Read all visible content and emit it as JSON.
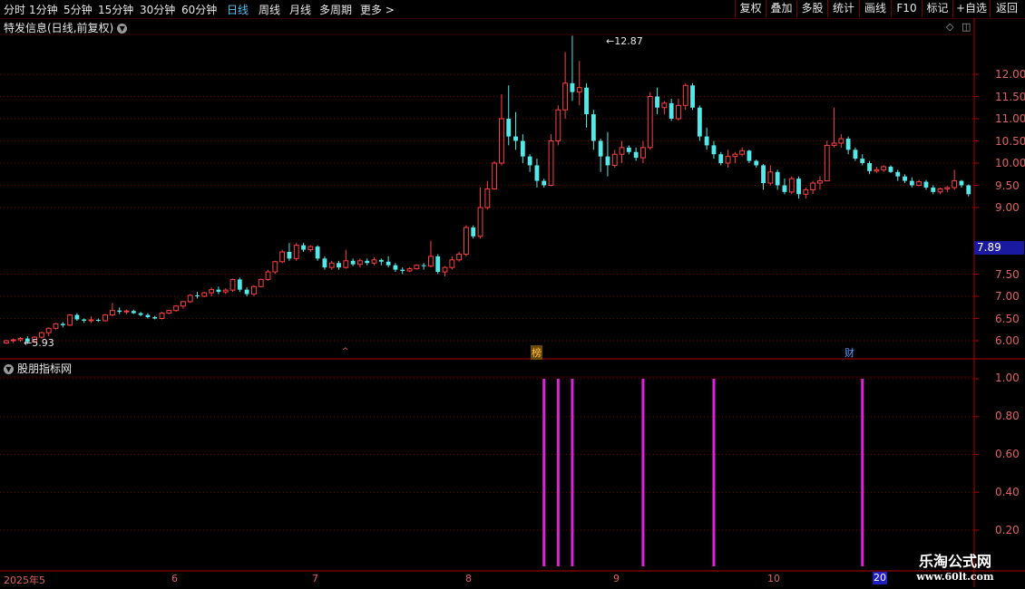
{
  "toolbar": {
    "periods": [
      "分时",
      "1分钟",
      "5分钟",
      "15分钟",
      "30分钟",
      "60分钟",
      "日线",
      "周线",
      "月线",
      "多周期",
      "更多 >"
    ],
    "active_period": "日线",
    "right_buttons": [
      "复权",
      "叠加",
      "多股",
      "统计",
      "画线",
      "F10",
      "标记",
      "+自选",
      "返回"
    ]
  },
  "price_panel": {
    "title": "特发信息(日线,前复权)",
    "high_label": "12.87",
    "low_label": "5.93",
    "current_price": "7.89",
    "y_ticks": [
      "12.00",
      "11.50",
      "11.00",
      "10.50",
      "10.00",
      "9.50",
      "9.00",
      "7.50",
      "7.00",
      "6.50",
      "6.00"
    ],
    "event_markers": [
      {
        "text": "榜",
        "color": "#e0a020"
      },
      {
        "text": "财",
        "color": "#3b82f6"
      },
      {
        "text": "^",
        "color": "#e04040"
      }
    ],
    "colors": {
      "up": "#ff4040",
      "down": "#54e8e8",
      "grid": "#7a0000"
    }
  },
  "indicator_panel": {
    "title": "股朋指标网",
    "y_ticks": [
      "1.00",
      "0.80",
      "0.60",
      "0.40",
      "0.20"
    ],
    "signal_color": "#e020e0"
  },
  "x_axis": {
    "labels": [
      "2025年5",
      "6",
      "7",
      "8",
      "9",
      "10"
    ],
    "current_label": "20"
  },
  "watermark": {
    "line1": "乐淘公式网",
    "line2": "www.60lt.com"
  },
  "chart_data": [
    {
      "type": "candlestick",
      "title": "特发信息(日线,前复权)",
      "x_labels": [
        "2025年5",
        "6",
        "7",
        "8",
        "9",
        "10",
        "20"
      ],
      "ylim": [
        5.7,
        13.0
      ],
      "candles": [
        [
          5.95,
          6.02,
          5.93,
          6.0
        ],
        [
          6.0,
          6.05,
          5.95,
          6.02
        ],
        [
          6.02,
          6.08,
          5.98,
          6.05
        ],
        [
          6.05,
          6.1,
          5.93,
          5.97
        ],
        [
          5.97,
          6.1,
          5.95,
          6.08
        ],
        [
          6.08,
          6.2,
          6.05,
          6.18
        ],
        [
          6.18,
          6.3,
          6.1,
          6.28
        ],
        [
          6.28,
          6.4,
          6.25,
          6.38
        ],
        [
          6.38,
          6.42,
          6.3,
          6.35
        ],
        [
          6.35,
          6.6,
          6.33,
          6.58
        ],
        [
          6.58,
          6.62,
          6.45,
          6.48
        ],
        [
          6.48,
          6.5,
          6.4,
          6.45
        ],
        [
          6.45,
          6.55,
          6.4,
          6.47
        ],
        [
          6.47,
          6.5,
          6.42,
          6.45
        ],
        [
          6.45,
          6.6,
          6.43,
          6.58
        ],
        [
          6.58,
          6.85,
          6.55,
          6.68
        ],
        [
          6.68,
          6.75,
          6.6,
          6.65
        ],
        [
          6.65,
          6.7,
          6.6,
          6.67
        ],
        [
          6.67,
          6.7,
          6.6,
          6.62
        ],
        [
          6.62,
          6.65,
          6.55,
          6.58
        ],
        [
          6.58,
          6.62,
          6.5,
          6.53
        ],
        [
          6.53,
          6.56,
          6.48,
          6.5
        ],
        [
          6.5,
          6.65,
          6.48,
          6.62
        ],
        [
          6.62,
          6.7,
          6.6,
          6.68
        ],
        [
          6.68,
          6.8,
          6.65,
          6.78
        ],
        [
          6.78,
          6.9,
          6.72,
          6.88
        ],
        [
          6.88,
          7.05,
          6.85,
          7.02
        ],
        [
          7.02,
          7.1,
          6.95,
          7.0
        ],
        [
          7.0,
          7.1,
          6.98,
          7.08
        ],
        [
          7.08,
          7.2,
          7.0,
          7.15
        ],
        [
          7.15,
          7.22,
          7.05,
          7.1
        ],
        [
          7.1,
          7.18,
          7.05,
          7.14
        ],
        [
          7.14,
          7.4,
          7.1,
          7.38
        ],
        [
          7.38,
          7.42,
          7.1,
          7.15
        ],
        [
          7.15,
          7.2,
          7.0,
          7.05
        ],
        [
          7.05,
          7.25,
          7.0,
          7.22
        ],
        [
          7.22,
          7.4,
          7.2,
          7.38
        ],
        [
          7.38,
          7.6,
          7.35,
          7.55
        ],
        [
          7.55,
          7.8,
          7.5,
          7.78
        ],
        [
          7.78,
          8.05,
          7.75,
          8.0
        ],
        [
          8.0,
          8.2,
          7.8,
          7.85
        ],
        [
          7.85,
          8.2,
          7.8,
          8.15
        ],
        [
          8.15,
          8.2,
          8.0,
          8.05
        ],
        [
          8.05,
          8.15,
          8.0,
          8.12
        ],
        [
          8.12,
          8.15,
          7.8,
          7.85
        ],
        [
          7.85,
          7.9,
          7.6,
          7.65
        ],
        [
          7.65,
          7.8,
          7.6,
          7.75
        ],
        [
          7.75,
          7.8,
          7.6,
          7.65
        ],
        [
          7.65,
          8.05,
          7.62,
          7.8
        ],
        [
          7.8,
          7.85,
          7.68,
          7.72
        ],
        [
          7.72,
          7.85,
          7.65,
          7.8
        ],
        [
          7.8,
          7.85,
          7.7,
          7.75
        ],
        [
          7.75,
          7.88,
          7.7,
          7.82
        ],
        [
          7.82,
          7.85,
          7.7,
          7.78
        ],
        [
          7.78,
          7.9,
          7.65,
          7.7
        ],
        [
          7.7,
          7.75,
          7.55,
          7.6
        ],
        [
          7.6,
          7.65,
          7.5,
          7.57
        ],
        [
          7.57,
          7.65,
          7.55,
          7.62
        ],
        [
          7.62,
          7.72,
          7.6,
          7.7
        ],
        [
          7.7,
          7.75,
          7.6,
          7.68
        ],
        [
          7.68,
          8.25,
          7.65,
          7.9
        ],
        [
          7.9,
          7.95,
          7.5,
          7.55
        ],
        [
          7.55,
          7.68,
          7.45,
          7.65
        ],
        [
          7.65,
          7.9,
          7.6,
          7.82
        ],
        [
          7.82,
          8.0,
          7.78,
          7.95
        ],
        [
          7.95,
          8.6,
          7.9,
          8.55
        ],
        [
          8.55,
          8.6,
          8.3,
          8.35
        ],
        [
          8.35,
          9.45,
          8.3,
          9.0
        ],
        [
          9.0,
          9.6,
          8.95,
          9.42
        ],
        [
          9.42,
          10.05,
          9.4,
          10.0
        ],
        [
          10.0,
          11.55,
          9.95,
          11.0
        ],
        [
          11.0,
          11.75,
          10.4,
          10.6
        ],
        [
          10.6,
          11.15,
          10.3,
          10.5
        ],
        [
          10.5,
          10.65,
          10.0,
          10.15
        ],
        [
          10.15,
          10.2,
          9.8,
          9.95
        ],
        [
          9.95,
          10.1,
          9.45,
          9.6
        ],
        [
          9.6,
          9.65,
          9.45,
          9.5
        ],
        [
          9.5,
          10.65,
          9.48,
          10.5
        ],
        [
          10.5,
          11.3,
          10.4,
          11.2
        ],
        [
          11.2,
          12.5,
          11.0,
          11.8
        ],
        [
          11.8,
          12.87,
          11.4,
          11.6
        ],
        [
          11.6,
          12.3,
          11.3,
          11.7
        ],
        [
          11.7,
          11.8,
          10.8,
          11.1
        ],
        [
          11.1,
          11.2,
          10.3,
          10.5
        ],
        [
          10.5,
          10.55,
          9.8,
          10.15
        ],
        [
          10.15,
          10.7,
          9.7,
          9.95
        ],
        [
          9.95,
          10.3,
          9.9,
          10.2
        ],
        [
          10.2,
          10.5,
          10.0,
          10.35
        ],
        [
          10.35,
          10.4,
          10.2,
          10.25
        ],
        [
          10.25,
          10.35,
          10.05,
          10.12
        ],
        [
          10.12,
          10.5,
          10.0,
          10.35
        ],
        [
          10.35,
          11.6,
          10.3,
          11.5
        ],
        [
          11.5,
          11.7,
          11.1,
          11.25
        ],
        [
          11.25,
          11.4,
          11.1,
          11.35
        ],
        [
          11.35,
          11.45,
          10.95,
          11.0
        ],
        [
          11.0,
          11.45,
          10.95,
          11.3
        ],
        [
          11.3,
          11.8,
          11.2,
          11.75
        ],
        [
          11.75,
          11.8,
          11.2,
          11.25
        ],
        [
          11.25,
          11.3,
          10.5,
          10.6
        ],
        [
          10.6,
          10.8,
          10.3,
          10.4
        ],
        [
          10.4,
          10.5,
          10.1,
          10.2
        ],
        [
          10.2,
          10.25,
          9.95,
          10.0
        ],
        [
          10.0,
          10.3,
          9.9,
          10.15
        ],
        [
          10.15,
          10.25,
          10.0,
          10.2
        ],
        [
          10.2,
          10.35,
          10.15,
          10.28
        ],
        [
          10.28,
          10.3,
          10.0,
          10.05
        ],
        [
          10.05,
          10.08,
          9.9,
          9.95
        ],
        [
          9.95,
          9.98,
          9.4,
          9.55
        ],
        [
          9.55,
          9.95,
          9.5,
          9.8
        ],
        [
          9.8,
          9.85,
          9.4,
          9.5
        ],
        [
          9.5,
          9.65,
          9.3,
          9.35
        ],
        [
          9.35,
          9.7,
          9.3,
          9.65
        ],
        [
          9.65,
          9.7,
          9.2,
          9.3
        ],
        [
          9.3,
          9.45,
          9.2,
          9.4
        ],
        [
          9.4,
          9.6,
          9.3,
          9.55
        ],
        [
          9.55,
          9.7,
          9.4,
          9.6
        ],
        [
          9.6,
          10.5,
          9.6,
          10.4
        ],
        [
          10.4,
          11.25,
          10.35,
          10.45
        ],
        [
          10.45,
          10.65,
          10.35,
          10.55
        ],
        [
          10.55,
          10.6,
          10.2,
          10.3
        ],
        [
          10.3,
          10.35,
          10.05,
          10.1
        ],
        [
          10.1,
          10.2,
          9.95,
          10.0
        ],
        [
          10.0,
          10.05,
          9.75,
          9.82
        ],
        [
          9.82,
          9.92,
          9.78,
          9.85
        ],
        [
          9.85,
          9.95,
          9.8,
          9.92
        ],
        [
          9.92,
          9.95,
          9.78,
          9.8
        ],
        [
          9.8,
          9.85,
          9.6,
          9.7
        ],
        [
          9.7,
          9.75,
          9.55,
          9.6
        ],
        [
          9.6,
          9.68,
          9.45,
          9.5
        ],
        [
          9.5,
          9.62,
          9.48,
          9.58
        ],
        [
          9.58,
          9.62,
          9.4,
          9.45
        ],
        [
          9.45,
          9.5,
          9.3,
          9.35
        ],
        [
          9.35,
          9.45,
          9.3,
          9.42
        ],
        [
          9.42,
          9.48,
          9.35,
          9.45
        ],
        [
          9.45,
          9.85,
          9.4,
          9.6
        ],
        [
          9.6,
          9.62,
          9.45,
          9.5
        ],
        [
          9.5,
          9.52,
          9.25,
          9.3
        ]
      ],
      "current_price": 7.89
    },
    {
      "type": "bar",
      "title": "股朋指标网",
      "ylim": [
        0.1,
        1.05
      ],
      "signal_candle_index": [
        76,
        78,
        80,
        90,
        100,
        121
      ],
      "values": [
        1,
        1,
        1,
        1,
        1,
        1
      ]
    }
  ]
}
